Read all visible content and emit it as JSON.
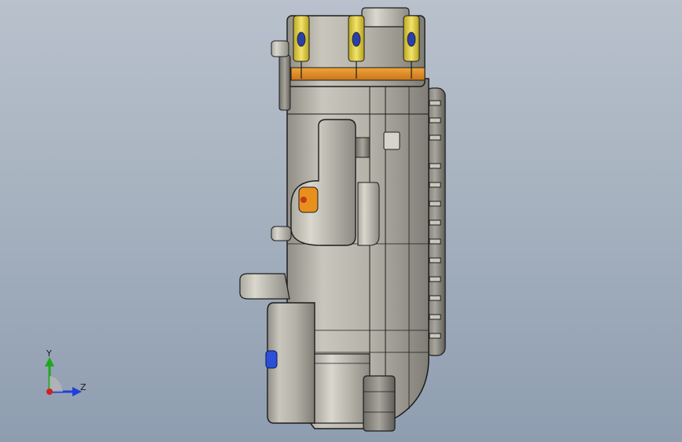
{
  "viewport": {
    "background_top": "#b8c1cc",
    "background_bottom": "#8e9db0"
  },
  "model": {
    "body_color": "#b4b2a8",
    "edge_color": "#1c1c1c",
    "connector_color": "#e6d23a",
    "pcb_color": "#e08a1c",
    "fastener_color": "#2b4fd6"
  },
  "triad": {
    "y_label": "Y",
    "z_label": "Z",
    "y_color": "#1fa81f",
    "z_color": "#1f3fd6",
    "x_color": "#d41f1f"
  }
}
